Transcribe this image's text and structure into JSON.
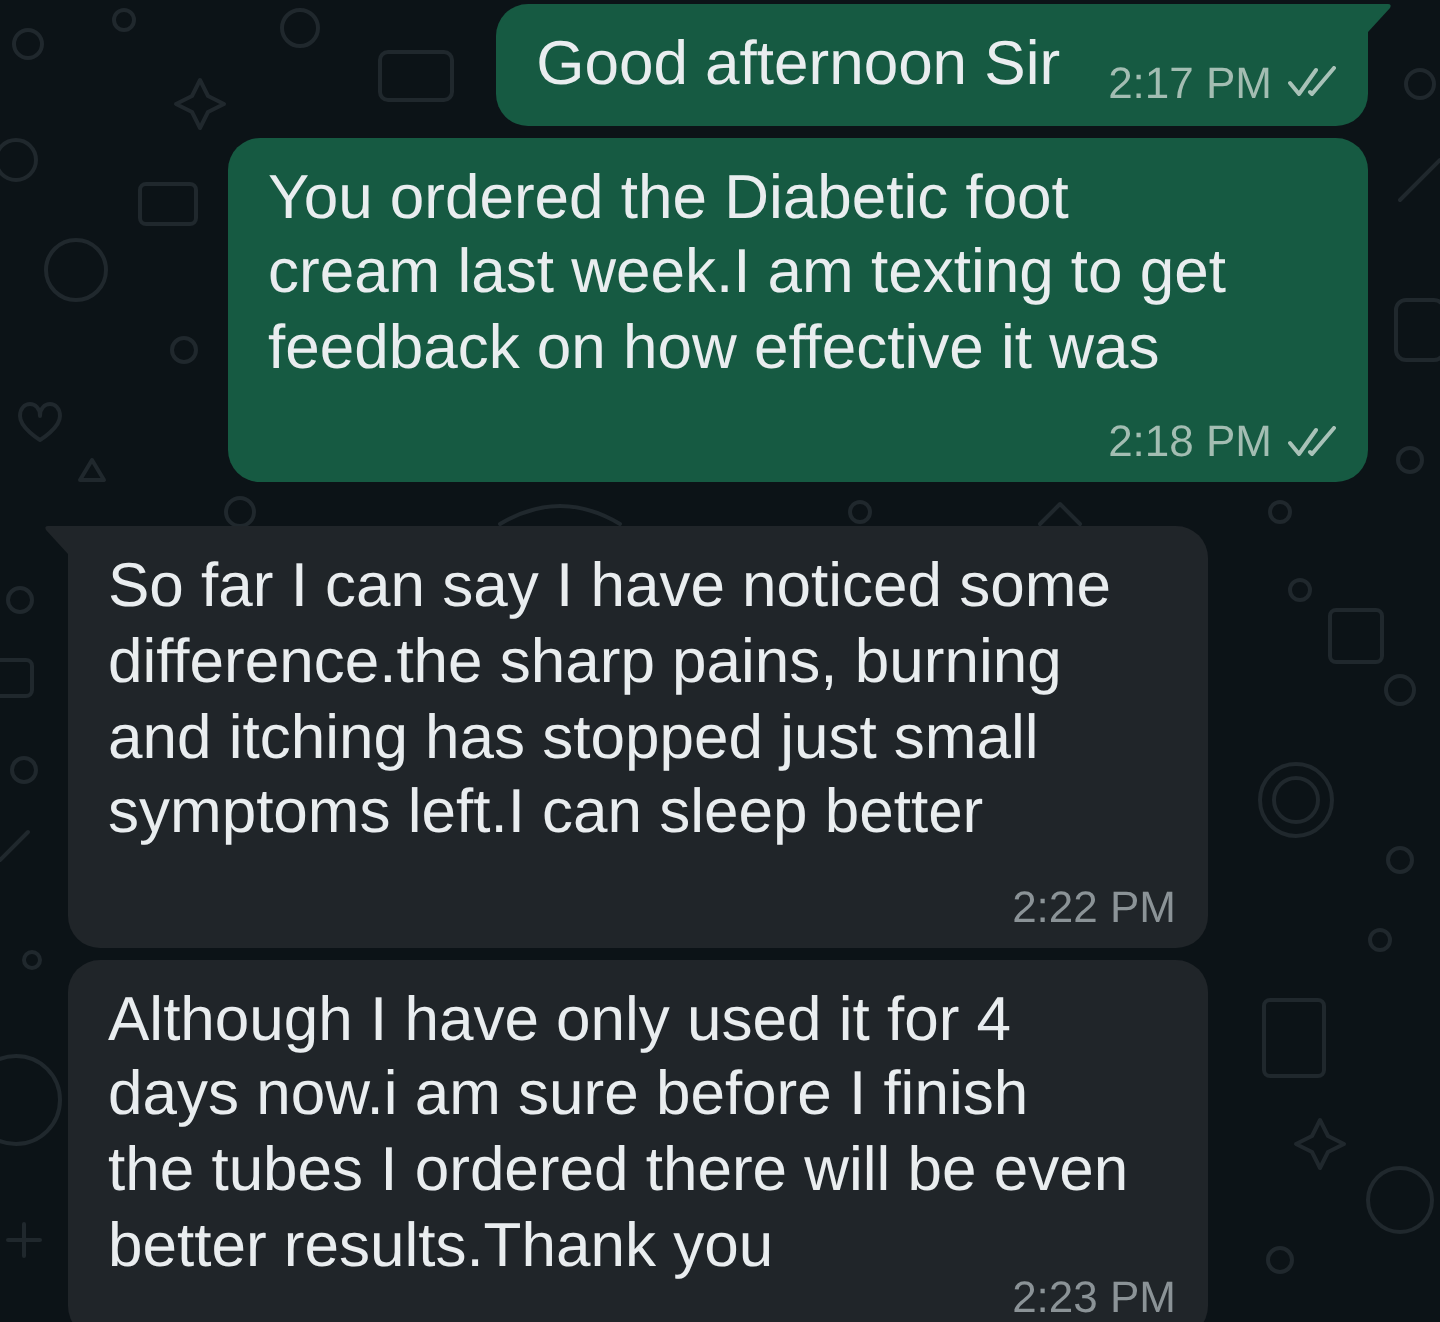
{
  "messages": [
    {
      "kind": "outgoing",
      "text": "Good afternoon Sir",
      "time": "2:17 PM",
      "read": false,
      "tail": true
    },
    {
      "kind": "outgoing",
      "text": "You ordered the Diabetic foot\ncream last week.I am texting to get\nfeedback on how effective it was",
      "time": "2:18 PM",
      "read": false,
      "tail": false
    },
    {
      "kind": "incoming",
      "text": "So far I can say I have noticed some\ndifference.the sharp pains, burning\nand itching has stopped just small\nsymptoms left.I can sleep better",
      "time": "2:22 PM",
      "tail": true
    },
    {
      "kind": "incoming",
      "text": "Although I have only used it for 4\ndays now.i am sure before I finish\nthe tubes I ordered there will be even\nbetter results.Thank you",
      "time": "2:23 PM",
      "tail": false
    }
  ]
}
